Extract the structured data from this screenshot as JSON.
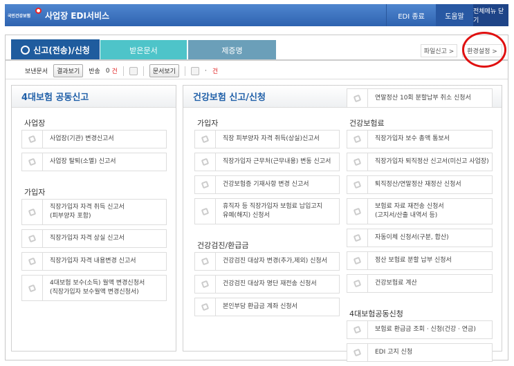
{
  "header": {
    "logo_text": "국민건강보험",
    "title": "사업장 EDI서비스",
    "edi_exit": "EDI 종료",
    "help": "도움말",
    "close_all_menu": "전체메뉴 닫기"
  },
  "tabs": [
    {
      "label": "신고(전송)/신청",
      "active": true
    },
    {
      "label": "받은문서"
    },
    {
      "label": "제증명"
    }
  ],
  "right_buttons": {
    "file_report": "파일신고 >",
    "settings": "환경설정 >"
  },
  "toolbar": {
    "sent_docs": "보낸문서",
    "view_results": "결과보기",
    "returned": "반송",
    "returned_count": "0",
    "unit": "건",
    "view_docs": "문서보기",
    "dot": "·",
    "unit2": "건"
  },
  "left_panel": {
    "title": "4대보험 공동신고",
    "sections": [
      {
        "title": "사업장",
        "items": [
          "사업장(기관) 변경신고서",
          "사업장 탈퇴(소멸) 신고서"
        ]
      },
      {
        "title": "가입자",
        "items": [
          "직장가입자 자격 취득 신고서\n(피부양자 포함)",
          "직장가입자 자격 상실 신고서",
          "직장가입자 자격 내용변경 신고서",
          "4대보험 보수(소득) 월액 변경신청서\n(직장가입자 보수월액 변경신청서)"
        ]
      }
    ]
  },
  "right_panel": {
    "title": "건강보험 신고/신청",
    "header_item": "연말정산 10회 분할납부 취소 신청서",
    "left_sections": [
      {
        "title": "가입자",
        "items": [
          "직장 피부양자 자격 취득(상실)신고서",
          "직장가입자 근무처(근무내용) 변동 신고서",
          "건강보험증 기재사항 변경 신고서",
          "휴직자 등 직장가입자 보험료 납입고지\n유예(해지) 신청서"
        ]
      },
      {
        "title": "건강검진/환급금",
        "items": [
          "건강검진 대상자 변경(추가,제외) 신청서",
          "건강검진 대상자 명단 재전송 신청서",
          "본인부담 환급금 계좌 신청서"
        ]
      }
    ],
    "right_sections": [
      {
        "title": "건강보험료",
        "items": [
          "직장가입자 보수 총액 통보서",
          "직장가입자 퇴직정산 신고서(미신고 사업장)",
          "퇴직정산/연말정산 재정산 신청서",
          "보험료 자료 재전송 신청서\n(고지서/산출 내역서 등)",
          "자동이체 신청서(구분, 합산)",
          "정산 보험료 분할 납부 신청서",
          "건강보험료 계산"
        ]
      },
      {
        "title": "4대보험공동신청",
        "items": [
          "보험료 환급금 조회 · 신청(건강 · 연금)",
          "EDI 고지 신청"
        ]
      }
    ]
  },
  "colors": {
    "header": "#2f63b0",
    "tab_active": "#1f5c9e",
    "tab_received": "#4ec4c9",
    "tab_cert": "#6b9fb9",
    "highlight_circle": "#e01010"
  }
}
